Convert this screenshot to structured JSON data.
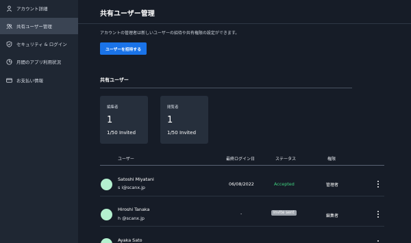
{
  "sidebar": {
    "items": [
      {
        "label": "アカウント詳細",
        "icon": "user-icon"
      },
      {
        "label": "共有ユーザー管理",
        "icon": "users-icon",
        "active": true
      },
      {
        "label": "セキュリティ & ログイン",
        "icon": "shield-icon"
      },
      {
        "label": "月間のアプリ利用状況",
        "icon": "pie-chart-icon"
      },
      {
        "label": "お支払い情報",
        "icon": "credit-card-icon"
      }
    ]
  },
  "main": {
    "title": "共有ユーザー管理",
    "description": "アカウントの管理者は新しいユーザーの招待や共有権限の設定ができます。",
    "invite_button": "ユーザーを招待する",
    "section_title": "共有ユーザー",
    "stats": [
      {
        "label": "編集者",
        "value": "1",
        "sub": "1/50 Invited"
      },
      {
        "label": "閲覧者",
        "value": "1",
        "sub": "1/50 Invited"
      }
    ],
    "table": {
      "headers": {
        "user": "ユーザー",
        "last_login": "最終ログイン日",
        "status": "ステータス",
        "role": "権限"
      },
      "rows": [
        {
          "name": "Satoshi Miyatani",
          "email": "s          i@scanx.jp",
          "last_login": "06/08/2022",
          "status": "Accepted",
          "role": "管理者"
        },
        {
          "name": "Hiroshi Tanaka",
          "email": "h          @scanx.jp",
          "last_login": "-",
          "status": "Invite sent",
          "role": "編集者"
        },
        {
          "name": "Ayaka Sato",
          "email": "",
          "last_login": "",
          "status": "",
          "role": ""
        }
      ]
    }
  },
  "colors": {
    "sidebar_bg": "#1f2733",
    "main_bg": "#161c27",
    "accent": "#1a73e8",
    "accepted": "#3fd17f",
    "avatar": "#b4f0cf"
  }
}
